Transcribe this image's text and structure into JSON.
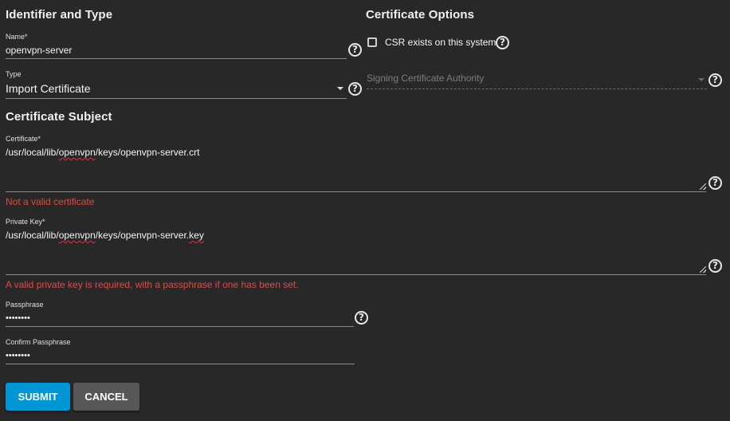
{
  "identifier_type": {
    "title": "Identifier and Type",
    "name": {
      "label": "Name",
      "required": "*",
      "value": "openvpn-server"
    },
    "type": {
      "label": "Type",
      "value": "Import Certificate"
    }
  },
  "certificate_options": {
    "title": "Certificate Options",
    "csr_checkbox": {
      "label": "CSR exists on this system",
      "checked": false
    },
    "signing_ca": {
      "placeholder": "Signing Certificate Authority"
    }
  },
  "certificate_subject": {
    "title": "Certificate Subject",
    "certificate": {
      "label": "Certificate",
      "required": "*",
      "value_parts": [
        "/usr/local/lib/",
        "openvpn",
        "/keys/openvpn-server.crt"
      ],
      "error": "Not a valid certificate"
    },
    "private_key": {
      "label": "Private Key",
      "required": "*",
      "value_parts": [
        "/usr/local/lib/",
        "openvpn",
        "/keys/openvpn-server.",
        "key"
      ],
      "error": "A valid private key is required, with a passphrase if one has been set."
    },
    "passphrase": {
      "label": "Passphrase",
      "value": "••••••••"
    },
    "confirm_passphrase": {
      "label": "Confirm Passphrase",
      "value": "••••••••"
    }
  },
  "help_glyph": "?",
  "buttons": {
    "submit": "SUBMIT",
    "cancel": "CANCEL"
  },
  "colors": {
    "background": "#282828",
    "primary": "#0095d5",
    "secondary": "#575757",
    "error": "#e5473f"
  }
}
